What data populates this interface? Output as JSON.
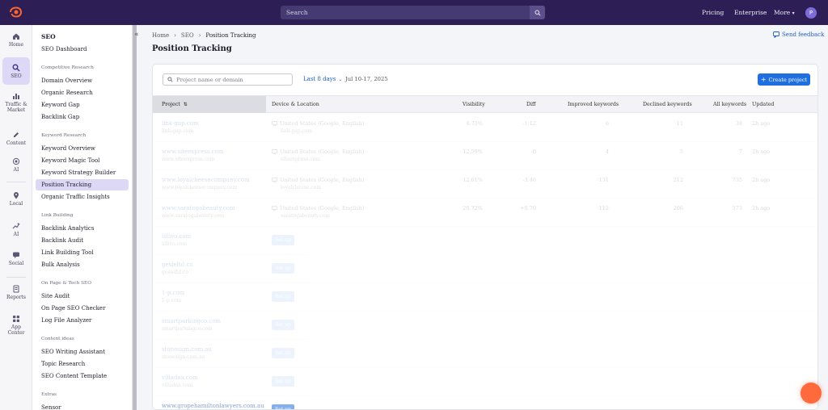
{
  "topbar": {
    "search_label": "Search",
    "links": [
      "Pricing",
      "Enterprise",
      "More"
    ],
    "avatar_letter": "P"
  },
  "rail": [
    {
      "label": "Home",
      "icon": "home-icon"
    },
    {
      "label": "SEO",
      "icon": "seo-icon",
      "active": true
    },
    {
      "label": "Traffic & Market",
      "icon": "traffic-icon"
    },
    {
      "label": "Content",
      "icon": "content-icon"
    },
    {
      "label": "AI",
      "icon": "ai-target-icon"
    },
    {
      "label": "Local",
      "icon": "location-pin-icon"
    },
    {
      "label": "AI",
      "icon": "sparkle-icon"
    },
    {
      "label": "Social",
      "icon": "social-icon"
    },
    {
      "label": "Reports",
      "icon": "reports-icon"
    },
    {
      "label": "App Center",
      "icon": "app-center-icon"
    }
  ],
  "submenu": {
    "title": "SEO",
    "dashboard": "SEO Dashboard",
    "sections": [
      {
        "name": "Competitive Research",
        "items": [
          "Domain Overview",
          "Organic Research",
          "Keyword Gap",
          "Backlink Gap"
        ]
      },
      {
        "name": "Keyword Research",
        "items": [
          "Keyword Overview",
          "Keyword Magic Tool",
          "Keyword Strategy Builder",
          "Position Tracking",
          "Organic Traffic Insights"
        ]
      },
      {
        "name": "Link Building",
        "items": [
          "Backlink Analytics",
          "Backlink Audit",
          "Link Building Tool",
          "Bulk Analysis"
        ]
      },
      {
        "name": "On Page & Tech SEO",
        "items": [
          "Site Audit",
          "On Page SEO Checker",
          "Log File Analyzer"
        ]
      },
      {
        "name": "Content ideas",
        "items": [
          "SEO Writing Assistant",
          "Topic Research",
          "SEO Content Template"
        ]
      },
      {
        "name": "Extras",
        "items": [
          "Sensor"
        ]
      }
    ],
    "active_item": "Position Tracking"
  },
  "breadcrumb": [
    "Home",
    "SEO",
    "Position Tracking"
  ],
  "page_title": "Position Tracking",
  "feedback_label": "Send feedback",
  "toolbar": {
    "search_placeholder": "Project name or domain",
    "period_label": "Last 8 days",
    "period_dates": "Jul 10-17, 2025",
    "create_label": "Create project"
  },
  "table": {
    "columns": [
      "Project",
      "Device & Location",
      "Visibility",
      "Diff",
      "Improved keywords",
      "Declined keywords",
      "All keywords",
      "Updated"
    ],
    "rows": [
      {
        "domain": "link-gap.com",
        "sub": "link-gap.com",
        "device": "United States (Google, English)",
        "loc": "link-gap.com",
        "vis": "4.75%",
        "diff": "-1.12",
        "imp": "6",
        "dec": "11",
        "all": "38",
        "upd": "2h ago"
      },
      {
        "domain": "www.siteexpress.com",
        "sub": "www.siteexpress.com",
        "device": "United States (Google, English)",
        "loc": "siteexpress.com",
        "vis": "12.59%",
        "diff": "0",
        "imp": "4",
        "dec": "5",
        "all": "7",
        "upd": "2h ago"
      },
      {
        "domain": "www.loyalcheesecompany.com",
        "sub": "www.loyalcheesecompany.com",
        "device": "United States (Google, English)",
        "loc": "loyalcheese.com",
        "vis": "12.61%",
        "diff": "-3.46",
        "imp": "131",
        "dec": "212",
        "all": "735",
        "upd": "2h ago"
      },
      {
        "domain": "www.saratogabeauty.com",
        "sub": "www.saratogabeauty.com",
        "device": "United States (Google, English)",
        "loc": "saratogabeauty.com",
        "vis": "20.72%",
        "diff": "+0.70",
        "imp": "112",
        "dec": "206",
        "all": "573",
        "upd": "2h ago"
      },
      {
        "domain": "lillivo.com",
        "sub": "lillivo.com",
        "setup": "Set up"
      },
      {
        "domain": "gesieltd.co",
        "sub": "gesieltd.co",
        "setup": "Set up"
      },
      {
        "domain": "1-p.com",
        "sub": "1-p.com",
        "setup": "Set up"
      },
      {
        "domain": "smartparkingco.com",
        "sub": "smartparkingco.com",
        "setup": "Set up"
      },
      {
        "domain": "stonesign.com.au",
        "sub": "stonesign.com.au",
        "setup": "Set up"
      },
      {
        "domain": "villadaa.com",
        "sub": "villadaa.com",
        "setup": "Set up"
      },
      {
        "domain": "www.gropehamiltonlawyers.com.au",
        "sub": "www.gropehamiltonlawyers.com.au",
        "setup": "Set up"
      }
    ]
  }
}
